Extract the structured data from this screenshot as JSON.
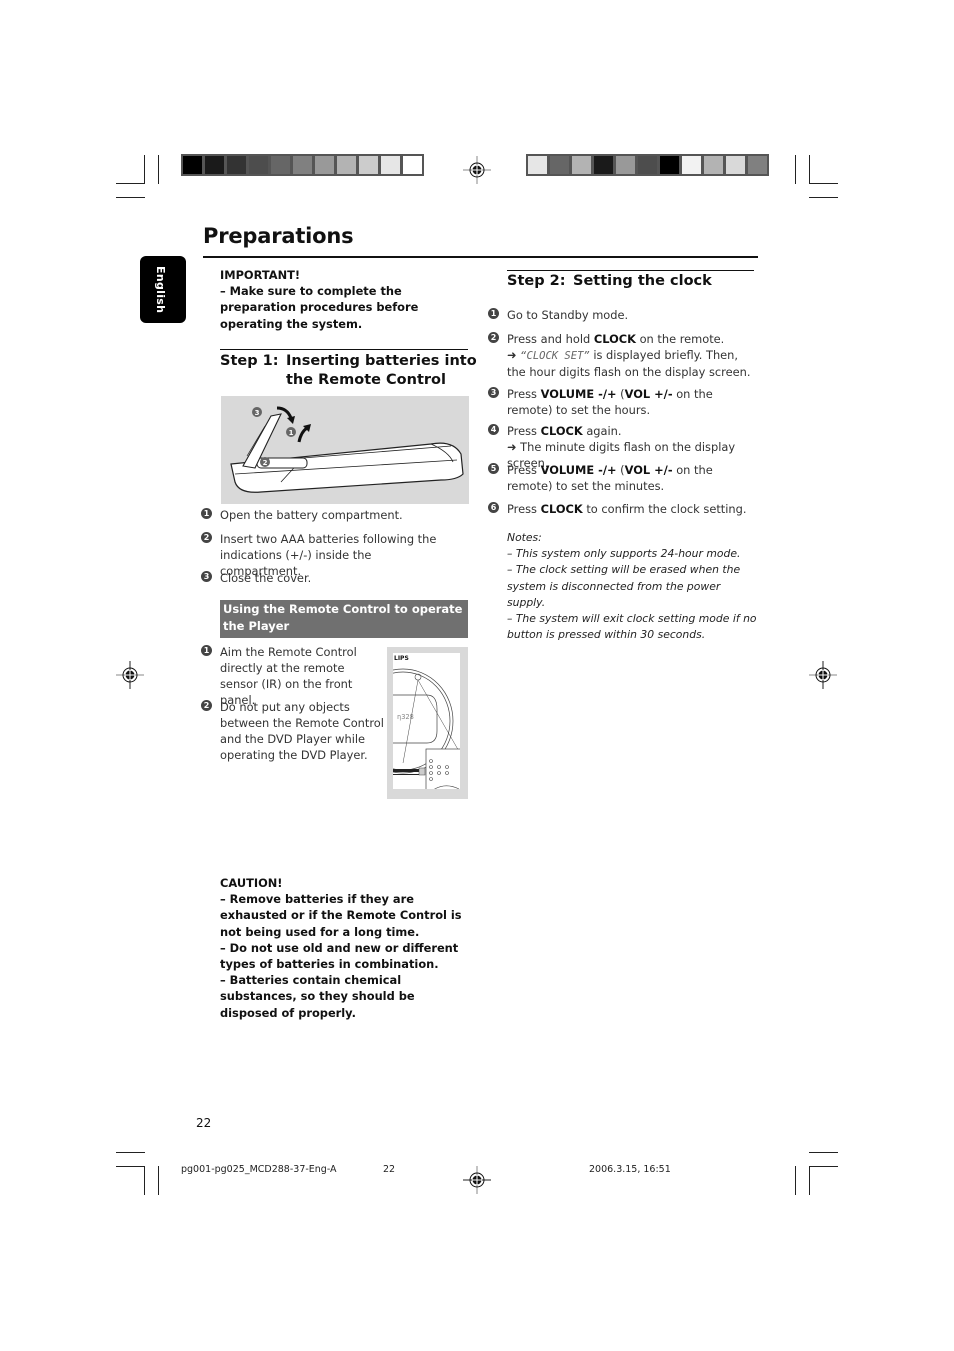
{
  "page": {
    "title": "Preparations",
    "language_tab": "English",
    "page_number": "22"
  },
  "important": {
    "heading": "IMPORTANT!",
    "text": "–  Make sure to complete the preparation procedures before operating the system."
  },
  "step1": {
    "label": "Step 1:",
    "title_line1": "Inserting batteries into",
    "title_line2": "the Remote Control",
    "figure": "remote-battery-compartment-illustration",
    "items": [
      {
        "num": "1",
        "text": "Open the battery compartment."
      },
      {
        "num": "2",
        "text": "Insert two AAA batteries following the indications (+/-) inside the compartment."
      },
      {
        "num": "3",
        "text": "Close the cover."
      }
    ]
  },
  "remote_usage": {
    "banner": "Using the Remote Control to operate the Player",
    "figure": "front-panel-ir-sensor-illustration",
    "figure_brand_fragment": "LIPS",
    "items": [
      {
        "num": "1",
        "text": "Aim the Remote Control directly at the remote sensor (IR) on the front panel."
      },
      {
        "num": "2",
        "text": "Do not put any objects between the Remote Control and the DVD Player while operating the DVD Player."
      }
    ]
  },
  "caution": {
    "heading": "CAUTION!",
    "lines": [
      "–  Remove batteries if they are exhausted or if the Remote Control is not being used for a long time.",
      "–  Do not use old and new or different types of batteries in combination.",
      "–  Batteries contain chemical substances, so they should be disposed of properly."
    ]
  },
  "step2": {
    "label": "Step 2:",
    "title": "Setting the clock",
    "items": [
      {
        "num": "1",
        "pre": "Go to Standby mode.",
        "key": "",
        "post": "",
        "key2": "",
        "post2": "",
        "sub": ""
      },
      {
        "num": "2",
        "pre": "Press and hold ",
        "key": "CLOCK",
        "post": " on the remote.",
        "key2": "",
        "post2": "",
        "sub_arrow": "➜",
        "sub_display": "“CLOCK SET”",
        "sub": " is displayed briefly. Then, the hour digits flash on the display screen."
      },
      {
        "num": "3",
        "pre": "Press ",
        "key": "VOLUME -/+",
        "post": " (",
        "key2": "VOL +/-",
        "post2": " on the remote) to set the hours."
      },
      {
        "num": "4",
        "pre": "Press ",
        "key": "CLOCK",
        "post": " again.",
        "sub_arrow": "➜",
        "sub": " The minute digits flash on the display screen."
      },
      {
        "num": "5",
        "pre": "Press ",
        "key": "VOLUME -/+",
        "post": " (",
        "key2": "VOL +/-",
        "post2": " on the remote) to set the minutes."
      },
      {
        "num": "6",
        "pre": "Press ",
        "key": "CLOCK",
        "post": " to confirm the clock setting."
      }
    ],
    "notes_heading": "Notes:",
    "notes": [
      "–  This system only supports 24-hour mode.",
      "–  The clock setting will be erased when the system is disconnected from the power supply.",
      "–  The system will exit clock setting mode if no button is pressed within 30 seconds."
    ]
  },
  "print_marks": {
    "colorbar_left": [
      "#000000",
      "#1a1a1a",
      "#333333",
      "#4d4d4d",
      "#666666",
      "#808080",
      "#999999",
      "#b3b3b3",
      "#cccccc",
      "#e6e6e6",
      "#ffffff"
    ],
    "colorbar_right": [
      "#e6e6e6",
      "#666666",
      "#b3b3b3",
      "#1a1a1a",
      "#999999",
      "#4d4d4d",
      "#000000",
      "#f2f2f2",
      "#b3b3b3",
      "#d9d9d9",
      "#808080"
    ],
    "footer_file": "pg001-pg025_MCD288-37-Eng-A",
    "footer_page": "22",
    "footer_timestamp": "2006.3.15, 16:51"
  }
}
